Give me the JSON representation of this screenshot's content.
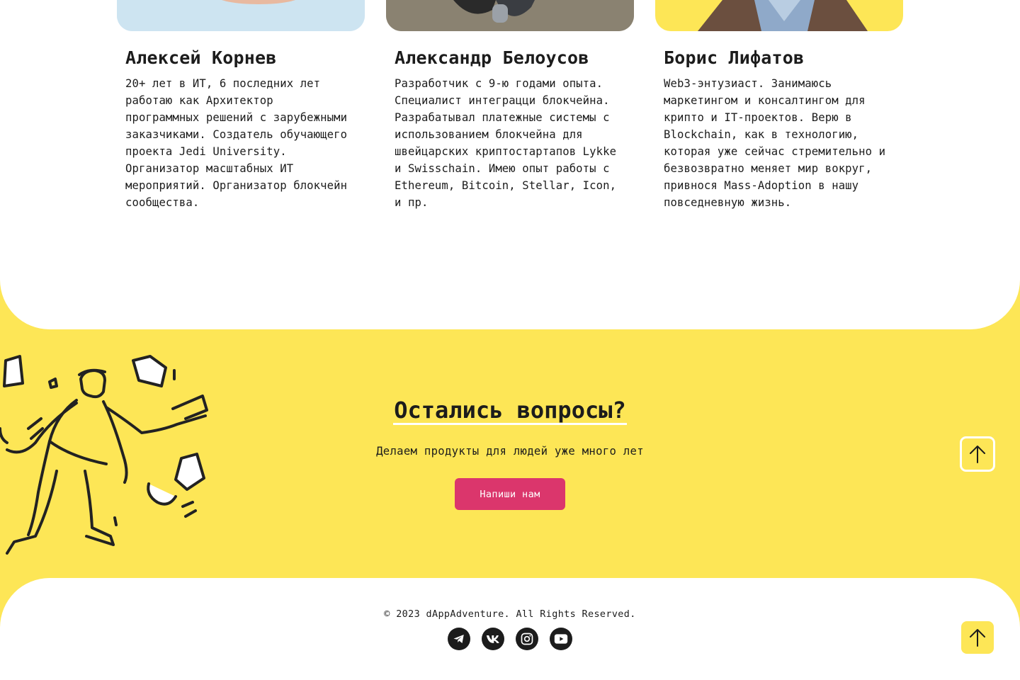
{
  "team": {
    "members": [
      {
        "name": "Алексей Корнев",
        "bio": "20+ лет в ИТ, 6 последних лет\nработаю как Архитектор\nпрограммных решений с зарубежными\nзаказчиками. Создатель обучающего\nпроекта Jedi University.\nОрганизатор масштабных ИТ\nмероприятий. Организатор блокчейн\nсообщества."
      },
      {
        "name": "Александр Белоусов",
        "bio": "Разработчик с 9-ю годами опыта.\nСпециалист интеграцци блокчейна.\nРазрабатывал платежные системы с\nиспользованием блокчейна для\nшвейцарских криптостартапов Lykke\nи Swisschain. Имею опыт работы с\nEthereum, Bitcoin, Stellar, Icon,\nи пр."
      },
      {
        "name": "Борис Лифатов",
        "bio": "Web3-энтузиаст. Занимаюсь\nмаркетингом и консалтингом для\nкрипто и IT-проектов. Верю в\nBlockchain, как в технологию,\nкоторая уже сейчас стремительно и\nбезвозвратно меняет мир вокруг,\nпривнося Mass-Adoption в нашу\nповседневную жизнь."
      }
    ]
  },
  "contact": {
    "title": "Остались вопросы?",
    "subtitle": "Делаем продукты для людей уже много лет",
    "cta_label": "Напиши нам"
  },
  "footer": {
    "copyright": "© 2023 dAppAdventure. All Rights Reserved.",
    "socials": [
      "telegram-icon",
      "vk-icon",
      "instagram-icon",
      "youtube-icon"
    ]
  },
  "colors": {
    "background_yellow": "#fde656",
    "accent_pink": "#db366c",
    "text_dark": "#1c1c1c",
    "white": "#ffffff"
  }
}
